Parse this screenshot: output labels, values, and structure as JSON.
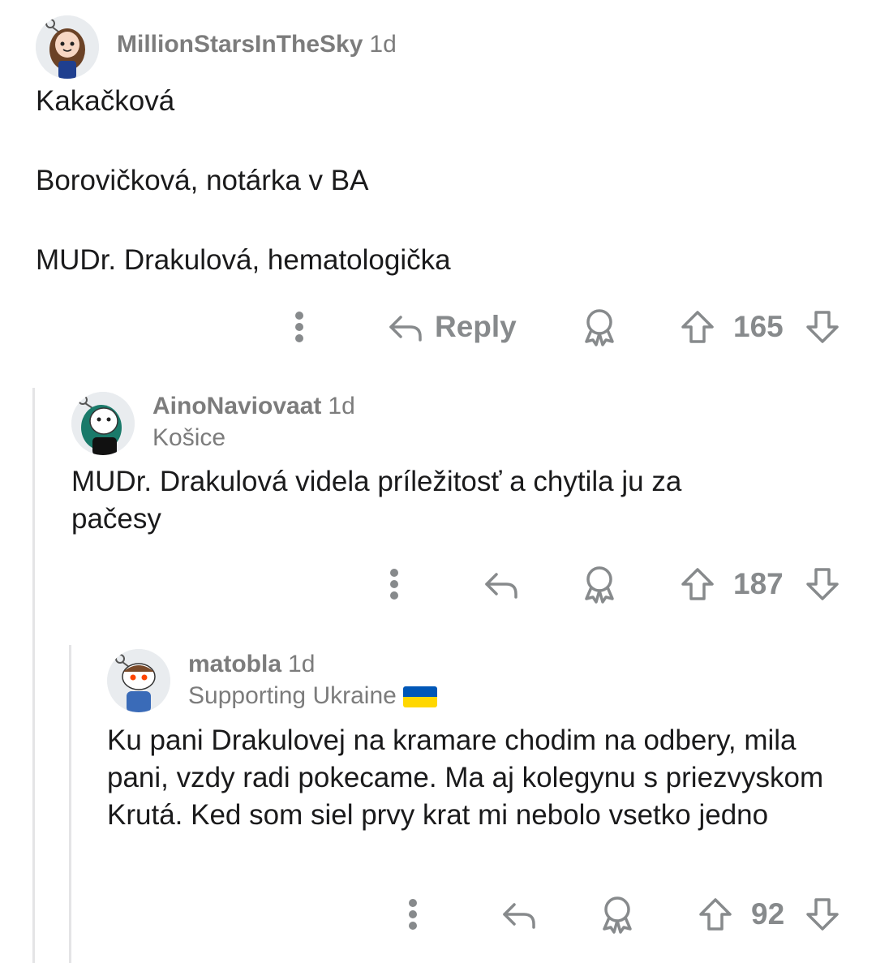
{
  "comments": [
    {
      "username": "MillionStarsInTheSky",
      "age": "1d",
      "flair": "",
      "paragraphs": [
        "Kakačková",
        "Borovičková, notárka v BA",
        "MUDr. Drakulová, hematologička"
      ],
      "reply_label": "Reply",
      "score": "165"
    },
    {
      "username": "AinoNaviovaat",
      "age": "1d",
      "flair": "Košice",
      "paragraphs": [
        "MUDr. Drakulová videla príležitosť a chytila ju za pačesy"
      ],
      "score": "187"
    },
    {
      "username": "matobla",
      "age": "1d",
      "flair": "Supporting Ukraine",
      "flair_emoji": "ukraine-flag",
      "paragraphs": [
        "Ku pani Drakulovej na kramare chodim na odbery, mila pani, vzdy radi pokecame. Ma aj kolegynu s priezvyskom Krutá. Ked som siel prvy krat mi nebolo vsetko jedno"
      ],
      "score": "92"
    }
  ],
  "colors": {
    "text": "#1a1a1b",
    "meta": "#7c7c7c",
    "icon": "#878a8c",
    "thread_line": "#e4e4e6",
    "flag_blue": "#0057b7",
    "flag_yellow": "#ffd700"
  },
  "icons": [
    "more-icon",
    "reply-icon",
    "award-icon",
    "upvote-icon",
    "downvote-icon"
  ]
}
